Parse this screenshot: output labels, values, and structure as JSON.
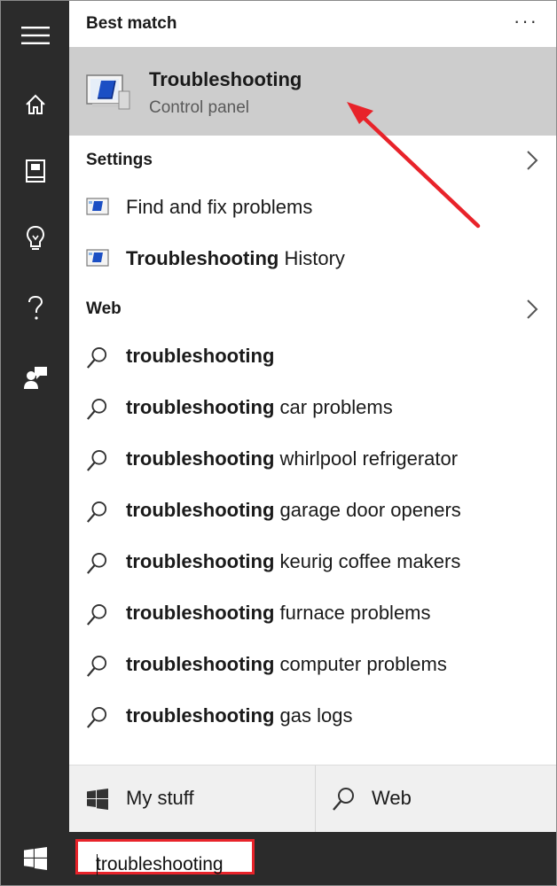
{
  "best_match": {
    "heading": "Best match",
    "more": "···",
    "title": "Troubleshooting",
    "subtitle": "Control panel"
  },
  "settings": {
    "heading": "Settings",
    "items": [
      {
        "bold": "",
        "rest": "Find and fix problems"
      },
      {
        "bold": "Troubleshooting",
        "rest": " History"
      }
    ]
  },
  "web": {
    "heading": "Web",
    "items": [
      {
        "bold": "troubleshooting",
        "rest": ""
      },
      {
        "bold": "troubleshooting",
        "rest": " car problems"
      },
      {
        "bold": "troubleshooting",
        "rest": " whirlpool refrigerator"
      },
      {
        "bold": "troubleshooting",
        "rest": " garage door openers"
      },
      {
        "bold": "troubleshooting",
        "rest": " keurig coffee makers"
      },
      {
        "bold": "troubleshooting",
        "rest": " furnace problems"
      },
      {
        "bold": "troubleshooting",
        "rest": " computer problems"
      },
      {
        "bold": "troubleshooting",
        "rest": " gas logs"
      }
    ]
  },
  "bottom": {
    "my_stuff": "My stuff",
    "web": "Web"
  },
  "search": {
    "value": "troubleshooting"
  },
  "icons": {
    "rail": [
      "menu-icon",
      "home-icon",
      "notebook-icon",
      "lightbulb-icon",
      "help-icon",
      "feedback-icon"
    ],
    "start": "windows-icon"
  },
  "colors": {
    "rail_bg": "#2b2b2b",
    "highlight_bg": "#cdcdcd",
    "annotation_red": "#e8232a"
  }
}
